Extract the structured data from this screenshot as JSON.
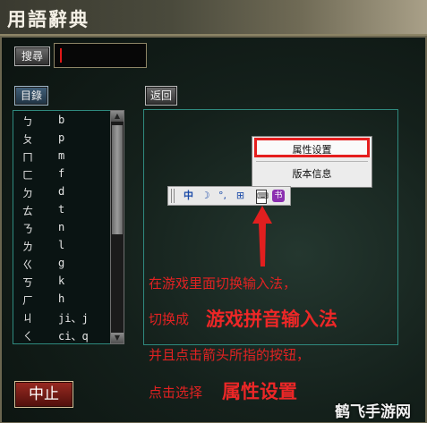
{
  "window": {
    "title": "用語辭典"
  },
  "search": {
    "button_label": "搜尋",
    "input_value": ""
  },
  "nav": {
    "index_label": "目錄",
    "back_label": "返回"
  },
  "list": {
    "items": [
      {
        "symbol": "ㄅ",
        "latin": "b"
      },
      {
        "symbol": "ㄆ",
        "latin": "p"
      },
      {
        "symbol": "ㄇ",
        "latin": "m"
      },
      {
        "symbol": "ㄈ",
        "latin": "f"
      },
      {
        "symbol": "ㄉ",
        "latin": "d"
      },
      {
        "symbol": "ㄊ",
        "latin": "t"
      },
      {
        "symbol": "ㄋ",
        "latin": "n"
      },
      {
        "symbol": "ㄌ",
        "latin": "l"
      },
      {
        "symbol": "ㄍ",
        "latin": "g"
      },
      {
        "symbol": "ㄎ",
        "latin": "k"
      },
      {
        "symbol": "ㄏ",
        "latin": "h"
      },
      {
        "symbol": "ㄐ",
        "latin": "ji、j"
      },
      {
        "symbol": "ㄑ",
        "latin": "ci、q"
      }
    ]
  },
  "context_menu": {
    "items": [
      "属性设置",
      "版本信息"
    ]
  },
  "ime_toolbar": {
    "tools": [
      "中",
      "☽",
      "°,",
      "⊞",
      "⌨",
      "书"
    ]
  },
  "instructions": {
    "line1": "在游戏里面切换输入法，",
    "line2_prefix": "切换成",
    "line2_emphasis": "游戏拼音输入法",
    "line3": "并且点击箭头所指的按钮，",
    "line4_prefix": "点击选择",
    "line4_emphasis": "属性设置"
  },
  "footer": {
    "stop_label": "中止"
  },
  "watermark": {
    "text": "鹤飞手游网"
  },
  "colors": {
    "highlight": "#e51e1e",
    "panel_border": "#2f8a7f"
  }
}
